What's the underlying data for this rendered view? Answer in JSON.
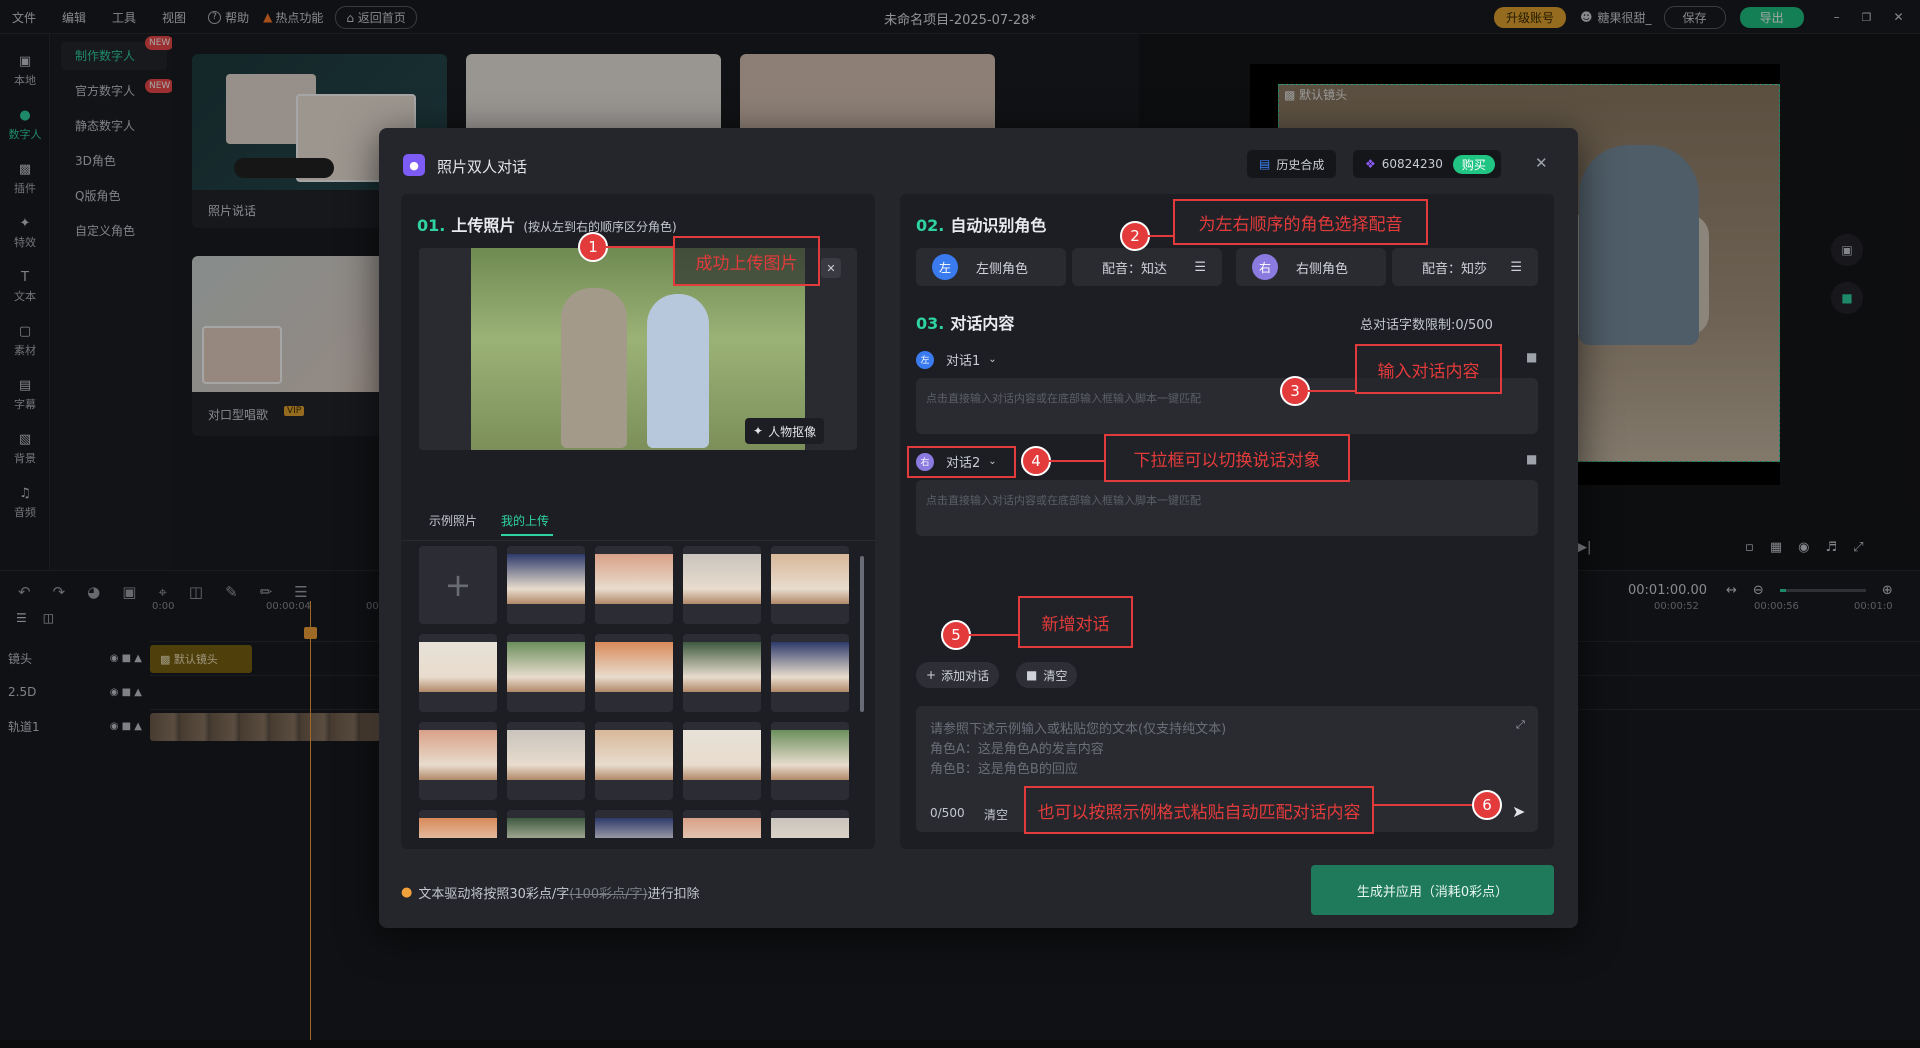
{
  "topbar": {
    "menus": [
      "文件",
      "编辑",
      "工具",
      "视图"
    ],
    "help": "帮助",
    "hot": "热点功能",
    "back_home": "返回首页",
    "project_title": "未命名项目-2025-07-28*",
    "upgrade": "升级账号",
    "username": "糖果很甜_",
    "save": "保存",
    "export": "导出"
  },
  "rail": [
    "本地",
    "数字人",
    "插件",
    "特效",
    "文本",
    "素材",
    "字幕",
    "背景",
    "音频"
  ],
  "submenu": {
    "items": [
      "制作数字人",
      "官方数字人",
      "静态数字人",
      "3D角色",
      "Q版角色",
      "自定义角色"
    ],
    "new_badge": "NEW"
  },
  "content": {
    "card1_label": "照片说话",
    "card2_label": "对口型唱歌",
    "vip": "VIP"
  },
  "preview": {
    "default_shot": "默认镜头"
  },
  "timeline": {
    "time_display": "00:01:00.00",
    "ruler_left": [
      "0:00",
      "00:00:04",
      "00"
    ],
    "ruler_right": [
      "00:00:52",
      "00:00:56",
      "00:01:0"
    ],
    "tracks": [
      "镜头",
      "2.5D",
      "轨道1"
    ],
    "clip_label": "默认镜头"
  },
  "modal": {
    "title": "照片双人对话",
    "history": "历史合成",
    "points": "60824230",
    "buy": "购买",
    "upload": {
      "num": "01.",
      "title": "上传照片",
      "hint": "(按从左到右的顺序区分角色)",
      "cutout": "人物抠像",
      "tabs": [
        "示例照片",
        "我的上传"
      ]
    },
    "roles": {
      "num": "02.",
      "title": "自动识别角色",
      "left_avatar": "左",
      "left_label": "左侧角色",
      "left_voice": "配音：知达",
      "right_avatar": "右",
      "right_label": "右侧角色",
      "right_voice": "配音：知莎"
    },
    "dialog": {
      "num": "03.",
      "title": "对话内容",
      "limit": "总对话字数限制:0/500",
      "items": [
        {
          "avatar": "左",
          "name": "对话1",
          "placeholder": "点击直接输入对话内容或在底部输入框输入脚本一键匹配"
        },
        {
          "avatar": "右",
          "name": "对话2",
          "placeholder": "点击直接输入对话内容或在底部输入框输入脚本一键匹配"
        }
      ],
      "add": "添加对话",
      "clear": "清空"
    },
    "script": {
      "line1": "请参照下述示例输入或粘贴您的文本(仅支持纯文本)",
      "line2": "角色A：这是角色A的发言内容",
      "line3": "角色B：这是角色B的回应",
      "count": "0/500",
      "clear": "清空"
    },
    "footer_prefix": "文本驱动将按照30彩点/字",
    "footer_strike": "(100彩点/字)",
    "footer_suffix": "进行扣除",
    "generate": "生成并应用（消耗0彩点）"
  },
  "annotations": [
    {
      "num": "1",
      "text": "成功上传图片"
    },
    {
      "num": "2",
      "text": "为左右顺序的角色选择配音"
    },
    {
      "num": "3",
      "text": "输入对话内容"
    },
    {
      "num": "4",
      "text": "下拉框可以切换说话对象"
    },
    {
      "num": "5",
      "text": "新增对话"
    },
    {
      "num": "6",
      "text": "也可以按照示例格式粘贴自动匹配对话内容"
    }
  ],
  "colors": {
    "accent": "#2ed3a0",
    "annotation": "#e33b3b",
    "generate_btn": "#1f7a5c"
  }
}
